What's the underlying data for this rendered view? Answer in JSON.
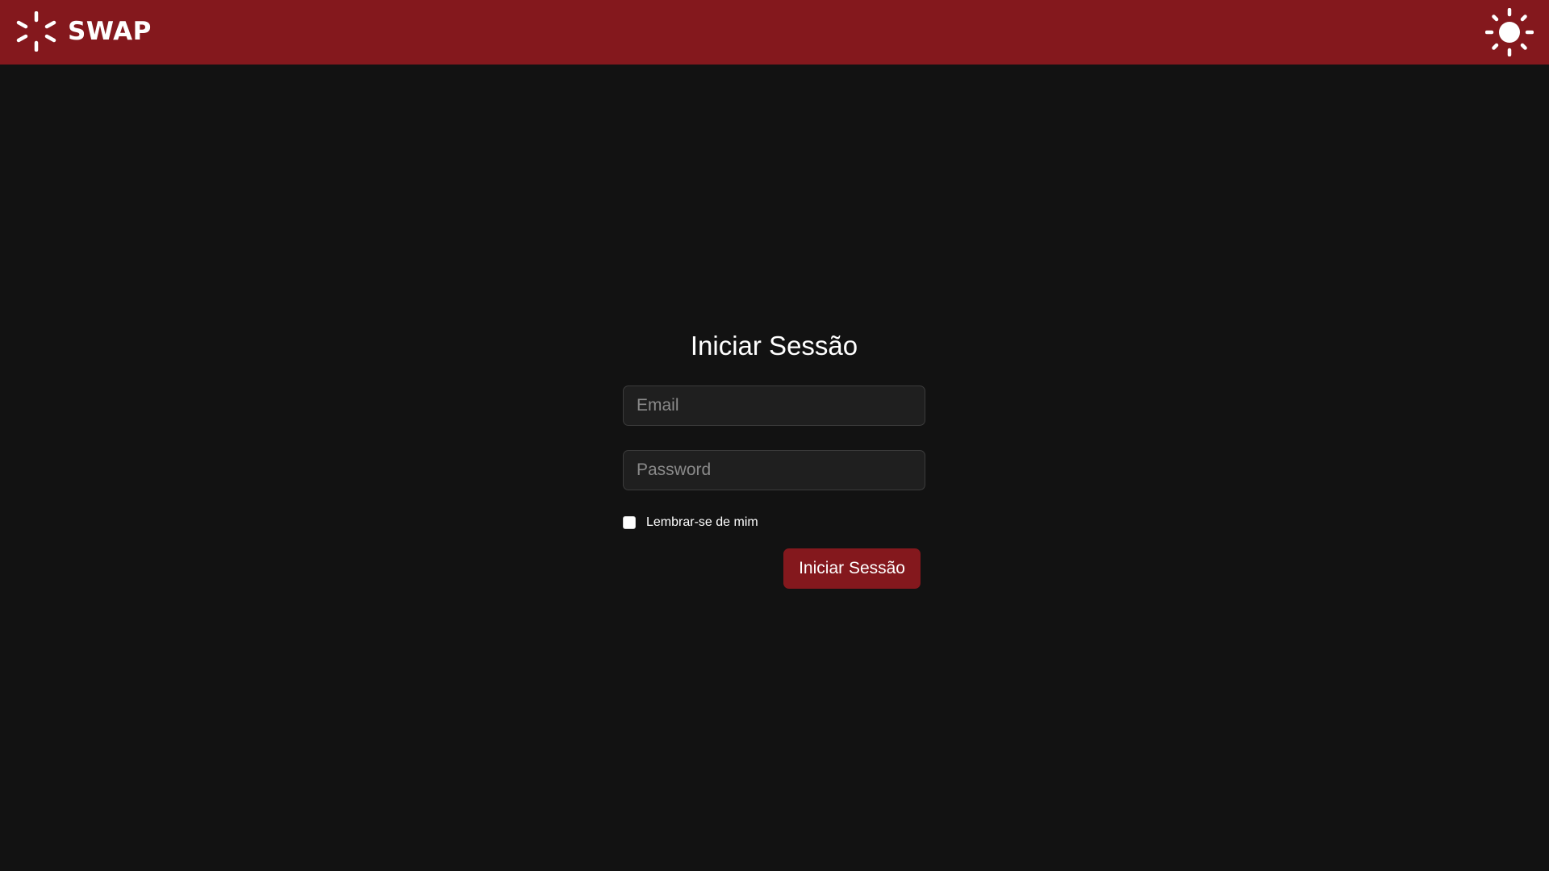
{
  "header": {
    "brand_name": "SWAP",
    "brand_icon": "asterisk-logo-icon",
    "theme_toggle_icon": "sun-icon",
    "background_color": "#84181d"
  },
  "login": {
    "title": "Iniciar Sessão",
    "email_placeholder": "Email",
    "email_value": "",
    "password_placeholder": "Password",
    "password_value": "",
    "remember_label": "Lembrar-se de mim",
    "remember_checked": false,
    "submit_label": "Iniciar Sessão"
  },
  "colors": {
    "accent": "#84181d",
    "background": "#121212",
    "input_background": "#1f1f1f"
  }
}
